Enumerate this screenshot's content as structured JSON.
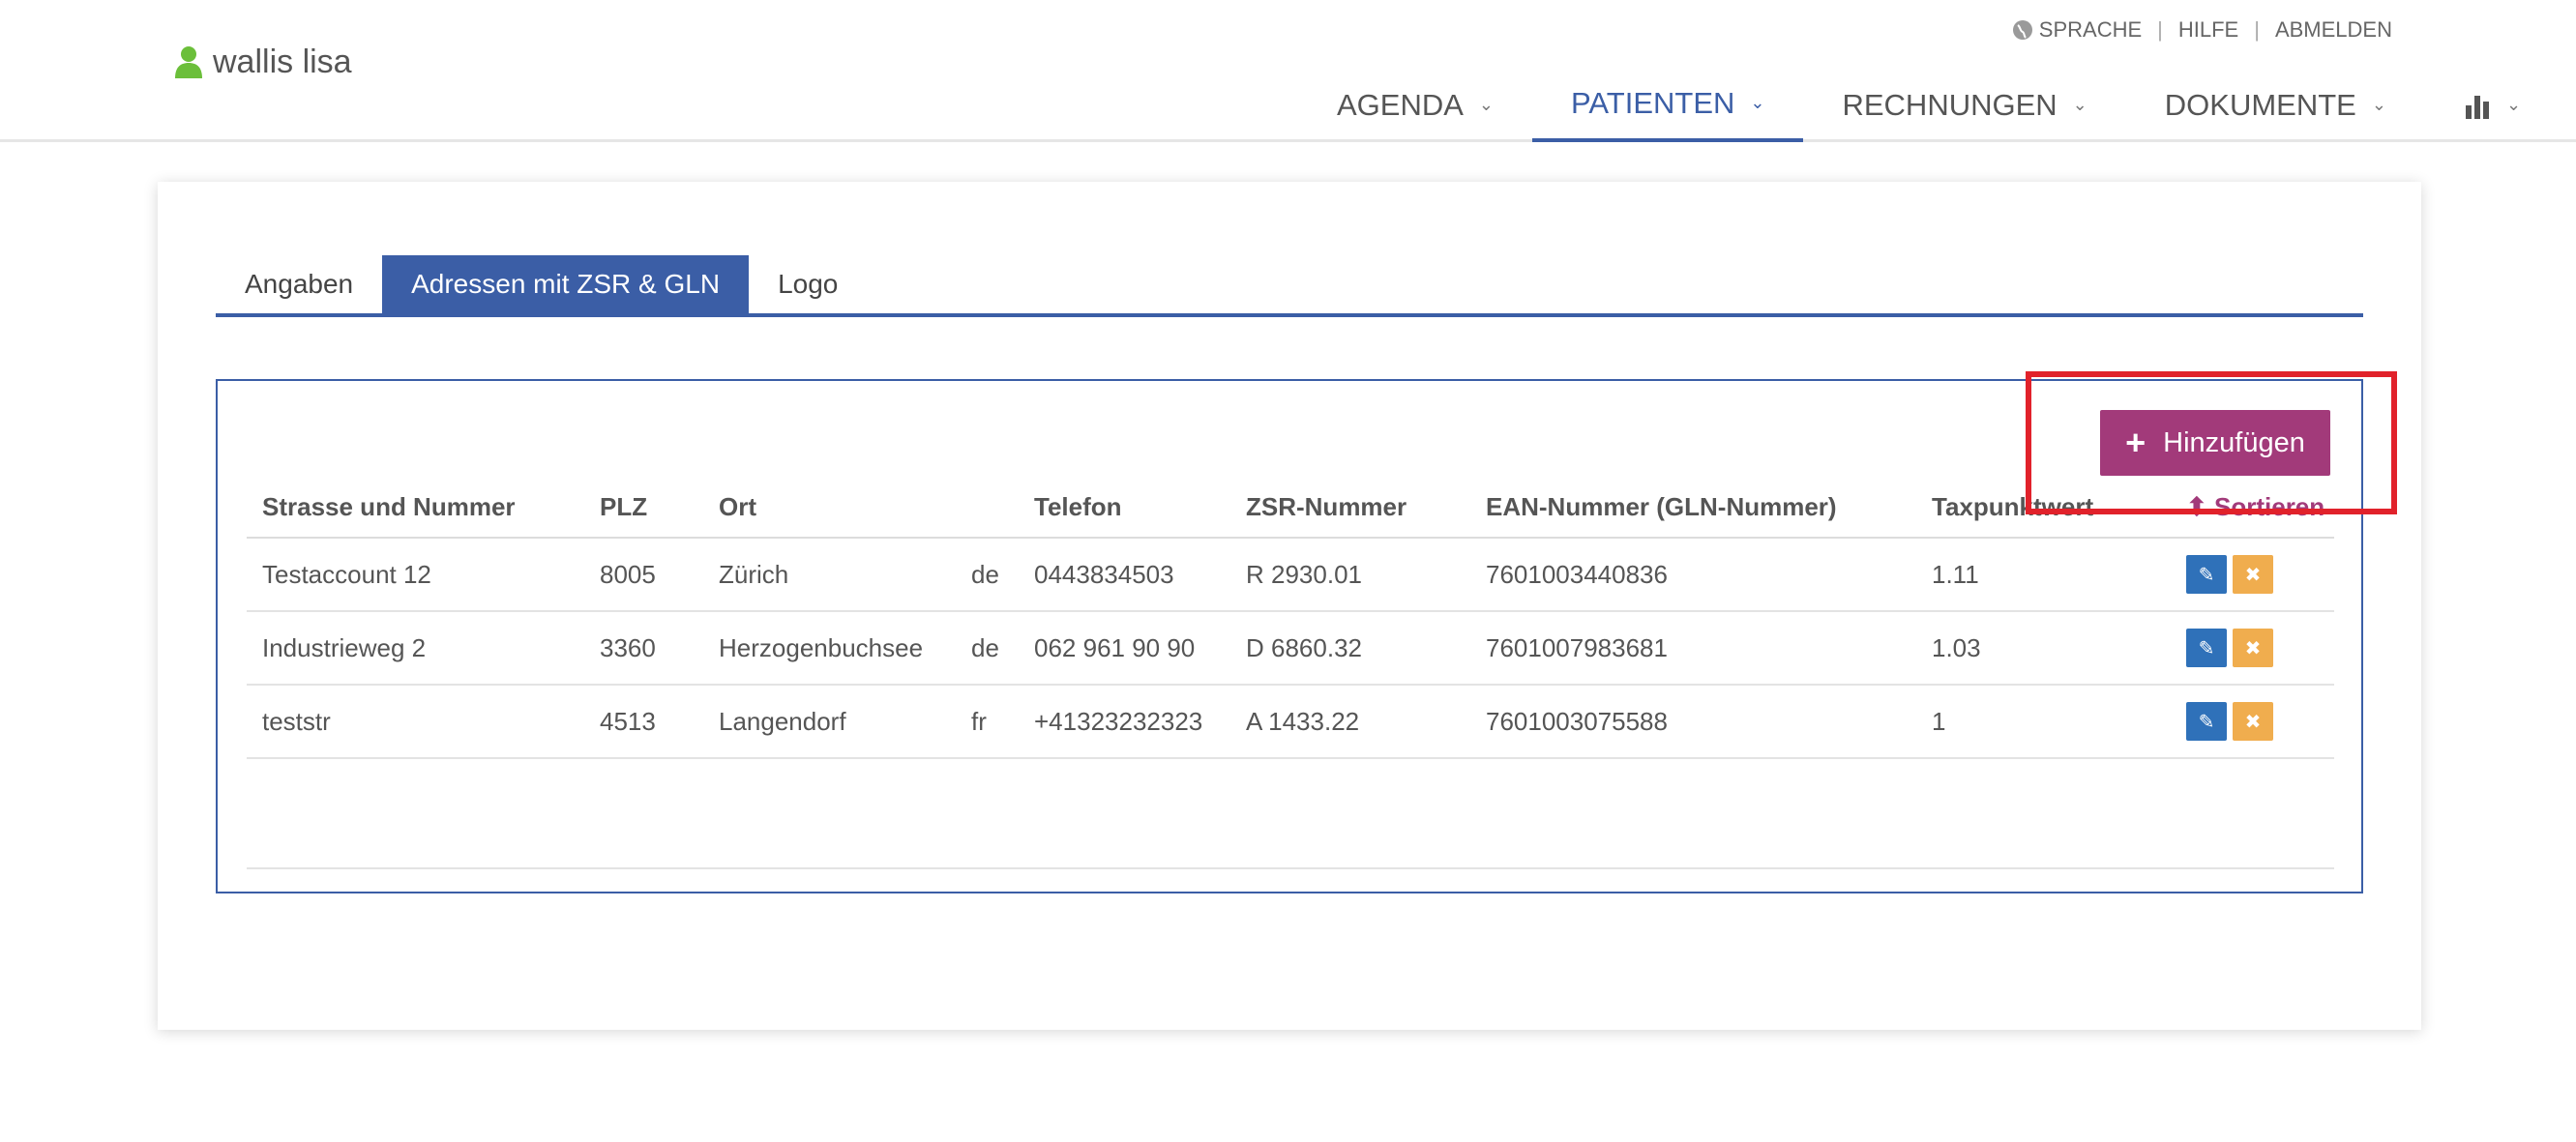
{
  "user": {
    "name": "wallis lisa",
    "icon": "user-icon",
    "icon_color": "#6bbf3a"
  },
  "toplinks": {
    "language_icon": "globe-icon",
    "language": "SPRACHE",
    "help": "HILFE",
    "logout": "ABMELDEN"
  },
  "nav": {
    "items": [
      {
        "label": "AGENDA",
        "chevron": "⌄"
      },
      {
        "label": "PATIENTEN",
        "chevron": "⌄"
      },
      {
        "label": "RECHNUNGEN",
        "chevron": "⌄"
      },
      {
        "label": "DOKUMENTE",
        "chevron": "⌄"
      }
    ],
    "stats_icon": "bar-chart-icon",
    "settings_icon": "gear-icon",
    "chevron": "⌄",
    "active_color": "#3b5ea6"
  },
  "tabs": [
    {
      "label": "Angaben"
    },
    {
      "label": "Adressen mit ZSR & GLN"
    },
    {
      "label": "Logo"
    }
  ],
  "add_button": {
    "icon": "plus-icon",
    "plus": "+",
    "label": "Hinzufügen",
    "color": "#a23a7a"
  },
  "table": {
    "headers": {
      "street": "Strasse und Nummer",
      "plz": "PLZ",
      "ort": "Ort",
      "lang": "",
      "telefon": "Telefon",
      "zsr": "ZSR-Nummer",
      "ean": "EAN-Nummer (GLN-Nummer)",
      "tax": "Taxpunktwert",
      "sort": "⬍ Sortieren"
    },
    "rows": [
      {
        "street": "Testaccount 12",
        "plz": "8005",
        "ort": "Zürich",
        "lang": "de",
        "telefon": "0443834503",
        "zsr": "R 2930.01",
        "ean": "7601003440836",
        "tax": "1.11"
      },
      {
        "street": "Industrieweg 2",
        "plz": "3360",
        "ort": "Herzogenbuchsee",
        "lang": "de",
        "telefon": "062 961 90 90",
        "zsr": "D 6860.32",
        "ean": "7601007983681",
        "tax": "1.03"
      },
      {
        "street": "teststr",
        "plz": "4513",
        "ort": "Langendorf",
        "lang": "fr",
        "telefon": "+41323232323",
        "zsr": "A 1433.22",
        "ean": "7601003075588",
        "tax": "1"
      }
    ],
    "edit_icon": "edit-icon",
    "delete_icon": "close-icon",
    "edit_glyph": "✎",
    "delete_glyph": "✖"
  },
  "highlight_color": "#e1222b"
}
